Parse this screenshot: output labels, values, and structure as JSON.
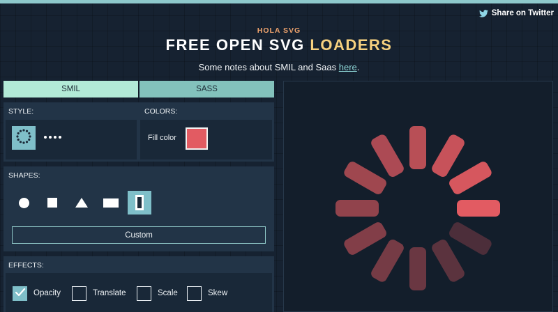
{
  "header": {
    "share_label": "Share on Twitter",
    "kicker": "HOLA SVG",
    "title_main": "FREE OPEN SVG",
    "title_highlight": "LOADERS",
    "notes_prefix": "Some notes about SMIL and Saas",
    "notes_link": "here",
    "notes_suffix": "."
  },
  "tabs": [
    {
      "label": "SMIL",
      "active": true
    },
    {
      "label": "SASS",
      "active": false
    }
  ],
  "style": {
    "label": "STYLE:",
    "options": [
      "dotted-ring",
      "four-dots"
    ],
    "selected": "dotted-ring"
  },
  "colors": {
    "label": "COLORS:",
    "fill_label": "Fill color",
    "fill_value": "#e25b62"
  },
  "shapes": {
    "label": "SHAPES:",
    "options": [
      "circle",
      "square",
      "triangle",
      "rectangle",
      "bar"
    ],
    "selected": "bar",
    "custom_label": "Custom"
  },
  "effects": {
    "label": "EFFECTS:",
    "items": [
      {
        "label": "Opacity",
        "checked": true
      },
      {
        "label": "Translate",
        "checked": false
      },
      {
        "label": "Scale",
        "checked": false
      },
      {
        "label": "Skew",
        "checked": false
      }
    ]
  },
  "theme": {
    "accent": "#7fbfc9",
    "loader_color": "#e25b62",
    "brand_orange": "#f0a46e",
    "brand_yellow": "#f7d17f"
  }
}
